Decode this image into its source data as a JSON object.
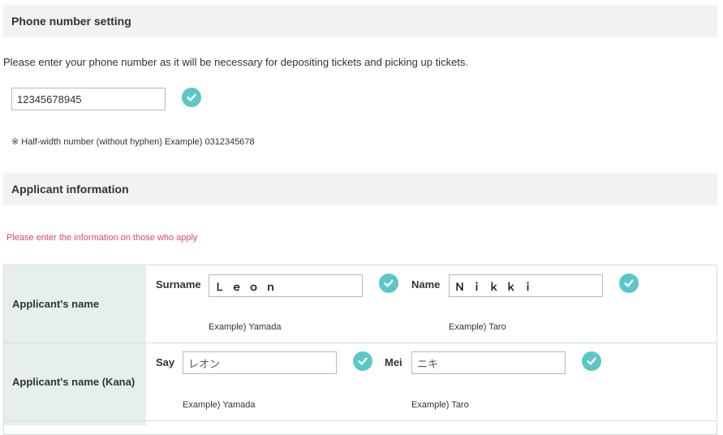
{
  "phone_section": {
    "title": "Phone number setting",
    "description": "Please enter your phone number as it will be necessary for depositing tickets and picking up tickets.",
    "phone_value": "12345678945",
    "note": "※ Half-width number (without hyphen) Example) 0312345678"
  },
  "applicant_section": {
    "title": "Applicant information",
    "warning": "Please enter the information on those who apply",
    "rows": [
      {
        "label": "Applicant's name",
        "field1": {
          "label": "Surname",
          "value": "Ｌｅｏｎ",
          "example": "Example) Yamada"
        },
        "field2": {
          "label": "Name",
          "value": "Ｎｉｋｋｉ",
          "example": "Example) Taro"
        }
      },
      {
        "label": "Applicant's name (Kana)",
        "field1": {
          "label": "Say",
          "value": "レオン",
          "example": "Example) Yamada"
        },
        "field2": {
          "label": "Mei",
          "value": "ニキ",
          "example": "Example) Taro"
        }
      }
    ]
  },
  "colors": {
    "check_accent": "#5cc7c7",
    "warning_text": "#e0436e",
    "header_bg": "#f2f2f2",
    "row_label_bg": "#e6eeee"
  },
  "icons": [
    "check-circle-icon"
  ]
}
